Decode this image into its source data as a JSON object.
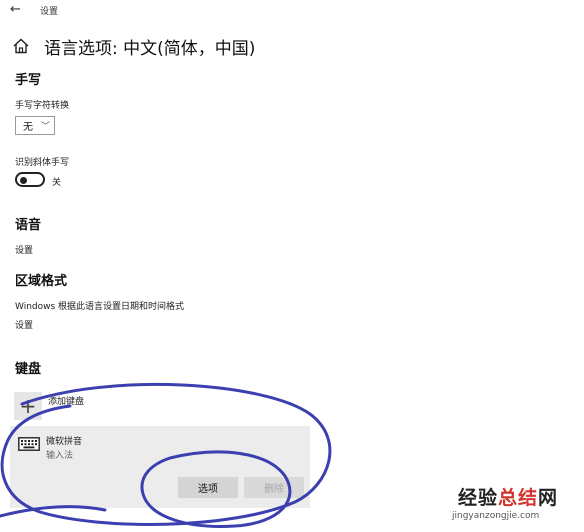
{
  "titlebar": {
    "back_glyph": "←",
    "title": "设置"
  },
  "header": {
    "home_icon": "home-icon",
    "page_title": "语言选项: 中文(简体，中国)"
  },
  "handwriting": {
    "section_title": "手写",
    "convert_label": "手写字符转换",
    "convert_value": "无",
    "italic_label": "识别斜体手写",
    "italic_toggle_state": "关",
    "italic_toggle_on": false
  },
  "speech": {
    "section_title": "语音",
    "settings_link": "设置"
  },
  "region": {
    "section_title": "区域格式",
    "description": "Windows 根据此语言设置日期和时间格式",
    "settings_link": "设置"
  },
  "keyboard": {
    "section_title": "键盘",
    "add_label": "添加键盘",
    "ime_name": "微软拼音",
    "ime_type": "输入法",
    "options_button": "选项",
    "delete_button": "删除"
  },
  "annotation": {
    "color": "#3b3fb0"
  },
  "watermark": {
    "main_black": "经验",
    "main_red": "总结",
    "main_end": "网",
    "url": "jingyanzongjie.com",
    "accent_color": "#d0342c"
  }
}
